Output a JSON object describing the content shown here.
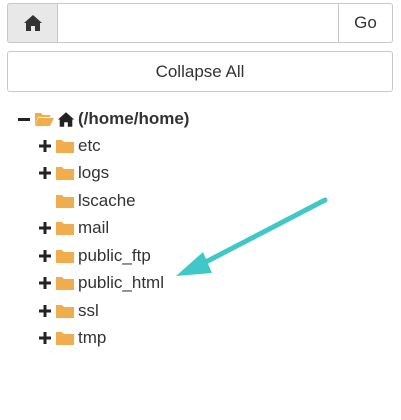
{
  "path_bar": {
    "home_icon": "home-icon",
    "input_value": "",
    "go_label": "Go"
  },
  "collapse_label": "Collapse All",
  "tree": {
    "root": {
      "label": "(/home/home)",
      "icon": "home-icon",
      "state": "expanded"
    },
    "items": [
      {
        "label": "etc",
        "expandable": true
      },
      {
        "label": "logs",
        "expandable": true
      },
      {
        "label": "lscache",
        "expandable": false
      },
      {
        "label": "mail",
        "expandable": true
      },
      {
        "label": "public_ftp",
        "expandable": true
      },
      {
        "label": "public_html",
        "expandable": true
      },
      {
        "label": "ssl",
        "expandable": true
      },
      {
        "label": "tmp",
        "expandable": true
      }
    ]
  },
  "colors": {
    "folder": "#f0ad4e",
    "arrow": "#40c8c8",
    "text": "#333333"
  }
}
